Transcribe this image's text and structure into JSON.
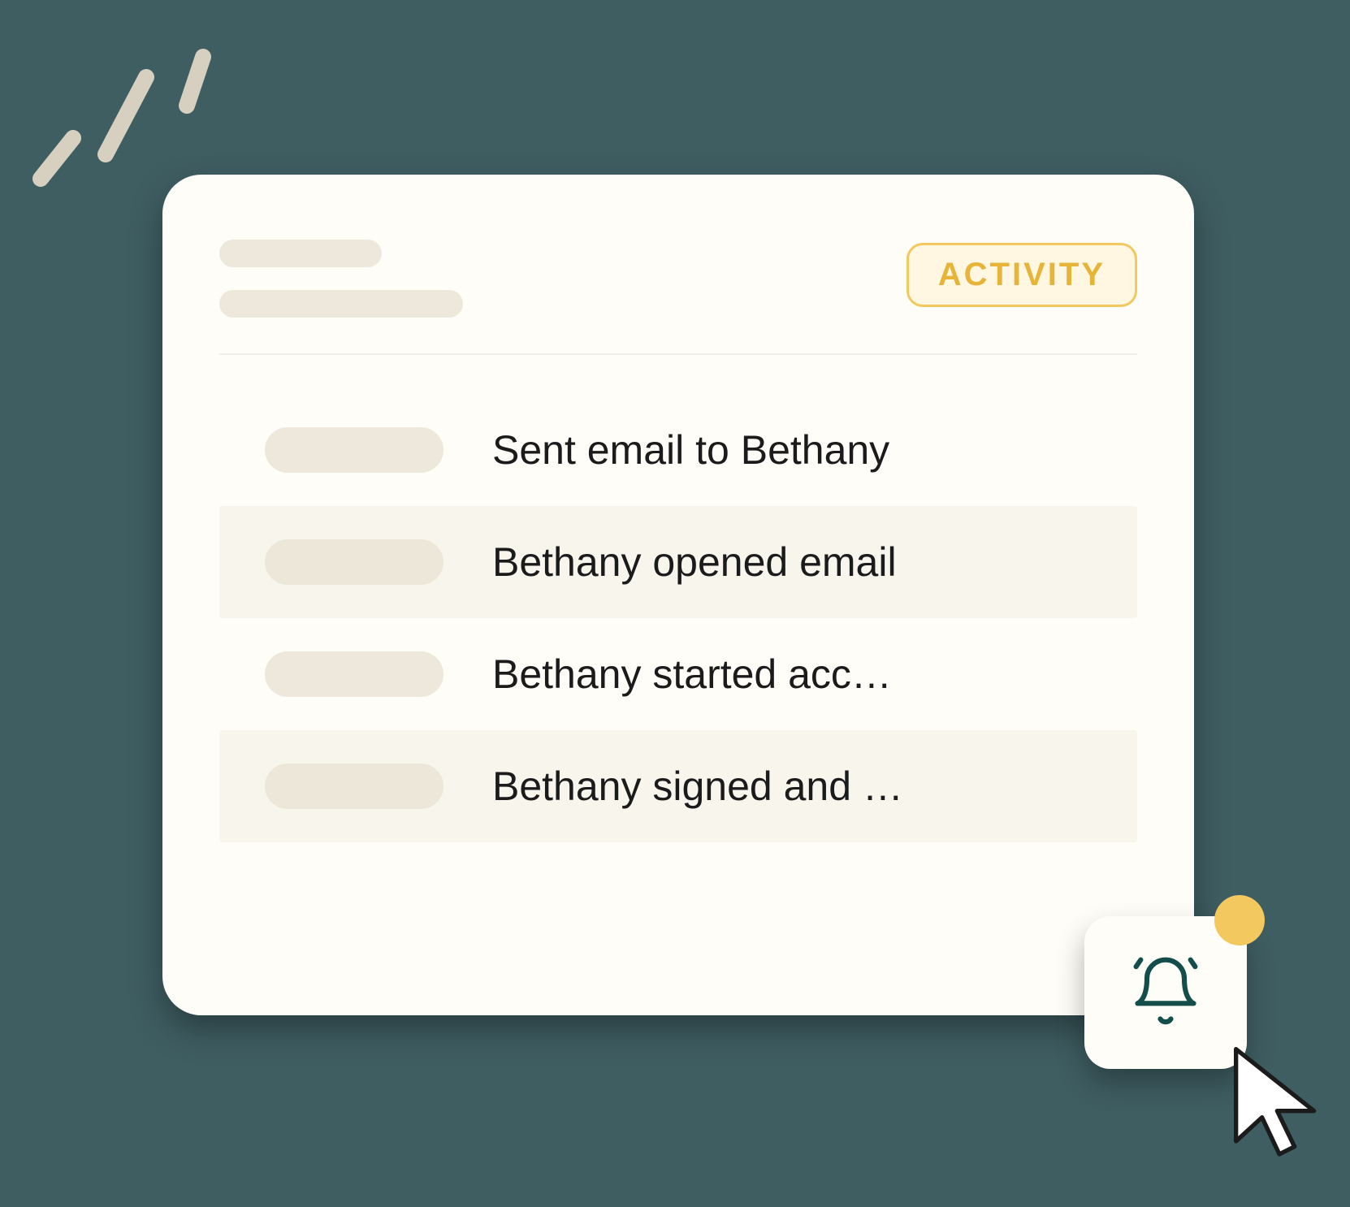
{
  "header": {
    "tab_label": "ACTIVITY"
  },
  "activity": {
    "items": [
      {
        "text": "Sent email to Bethany"
      },
      {
        "text": "Bethany opened email"
      },
      {
        "text": "Bethany started acc…"
      },
      {
        "text": "Bethany signed and …"
      }
    ]
  },
  "notification": {
    "icon": "bell-ringing-icon",
    "has_badge": true
  },
  "colors": {
    "panel_bg": "#fffdf7",
    "page_bg": "#3f5e62",
    "accent_yellow": "#f3c95f",
    "skeleton": "#eee8dc",
    "row_alt": "#f8f5ed",
    "bell_stroke": "#134e4a"
  }
}
